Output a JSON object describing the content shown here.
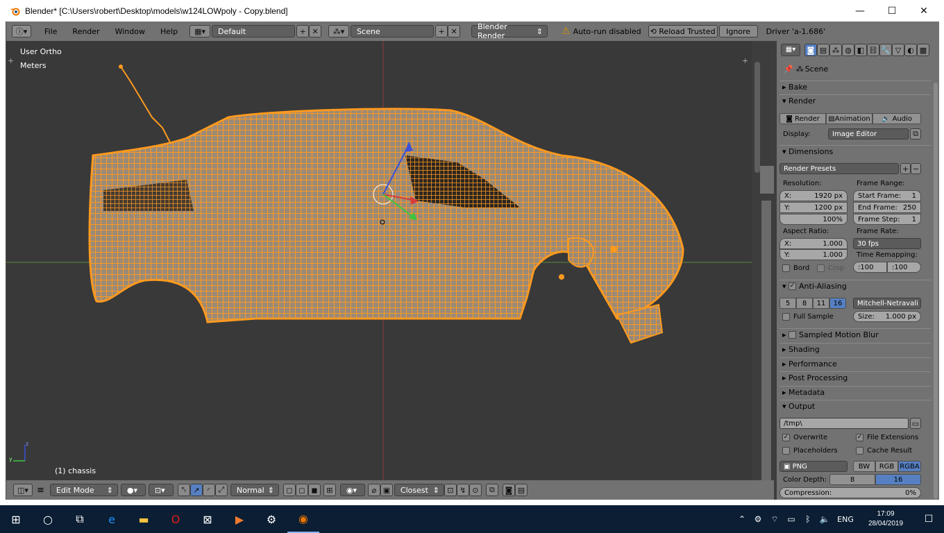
{
  "window": {
    "title": "Blender* [C:\\Users\\robert\\Desktop\\models\\w124LOWpoly - Copy.blend]",
    "minimize": "—",
    "maximize": "☐",
    "close": "✕"
  },
  "info_header": {
    "menus": [
      "File",
      "Render",
      "Window",
      "Help"
    ],
    "layout": "Default",
    "scene": "Scene",
    "engine": "Blender Render",
    "warning": "Auto-run disabled",
    "reload_trusted": "Reload Trusted",
    "ignore": "Ignore",
    "driver": "Driver 'a-1.686'"
  },
  "viewport": {
    "view_name": "User Ortho",
    "units": "Meters",
    "object_label": "(1) chassis",
    "axis_z": "z",
    "axis_y": "y"
  },
  "viewport_header": {
    "mode": "Edit Mode",
    "orientation": "Normal",
    "snap_target": "Closest"
  },
  "properties": {
    "context": "Scene",
    "panels": {
      "bake": "Bake",
      "render": "Render",
      "render_btn": "Render",
      "animation_btn": "Animation",
      "audio_btn": "Audio",
      "display_label": "Display:",
      "display_value": "Image Editor",
      "dimensions": "Dimensions",
      "render_presets": "Render Presets",
      "resolution_label": "Resolution:",
      "res_x_label": "X:",
      "res_x": "1920 px",
      "res_y_label": "Y:",
      "res_y": "1200 px",
      "res_pct": "100%",
      "frame_range_label": "Frame Range:",
      "start_frame_label": "Start Frame:",
      "start_frame": "1",
      "end_frame_label": "End Frame:",
      "end_frame": "250",
      "frame_step_label": "Frame Step:",
      "frame_step": "1",
      "aspect_label": "Aspect Ratio:",
      "aspect_x_label": "X:",
      "aspect_x": "1.000",
      "aspect_y_label": "Y:",
      "aspect_y": "1.000",
      "frame_rate_label": "Frame Rate:",
      "frame_rate": "30 fps",
      "time_remap_label": "Time Remapping:",
      "remap_old": ":100",
      "remap_new": ":100",
      "bord": "Bord",
      "crop": "Crop",
      "anti_aliasing": "Anti-Aliasing",
      "aa_samples": [
        "5",
        "8",
        "11",
        "16"
      ],
      "aa_filter": "Mitchell-Netravali",
      "full_sample": "Full Sample",
      "size_label": "Size:",
      "size_value": "1.000 px",
      "sampled_motion_blur": "Sampled Motion Blur",
      "shading": "Shading",
      "performance": "Performance",
      "post_processing": "Post Processing",
      "metadata": "Metadata",
      "output": "Output",
      "output_path": "/tmp\\",
      "overwrite": "Overwrite",
      "file_extensions": "File Extensions",
      "placeholders": "Placeholders",
      "cache_result": "Cache Result",
      "format": "PNG",
      "bw": "BW",
      "rgb": "RGB",
      "rgba": "RGBA",
      "color_depth_label": "Color Depth:",
      "depth_8": "8",
      "depth_16": "16",
      "compression_label": "Compression:",
      "compression_value": "0%"
    }
  },
  "taskbar": {
    "language": "ENG",
    "time": "17:09",
    "date": "28/04/2019"
  },
  "colors": {
    "accent_blue": "#5680c2",
    "mesh_orange": "#ff9a1f",
    "viewport_bg": "#393939"
  }
}
